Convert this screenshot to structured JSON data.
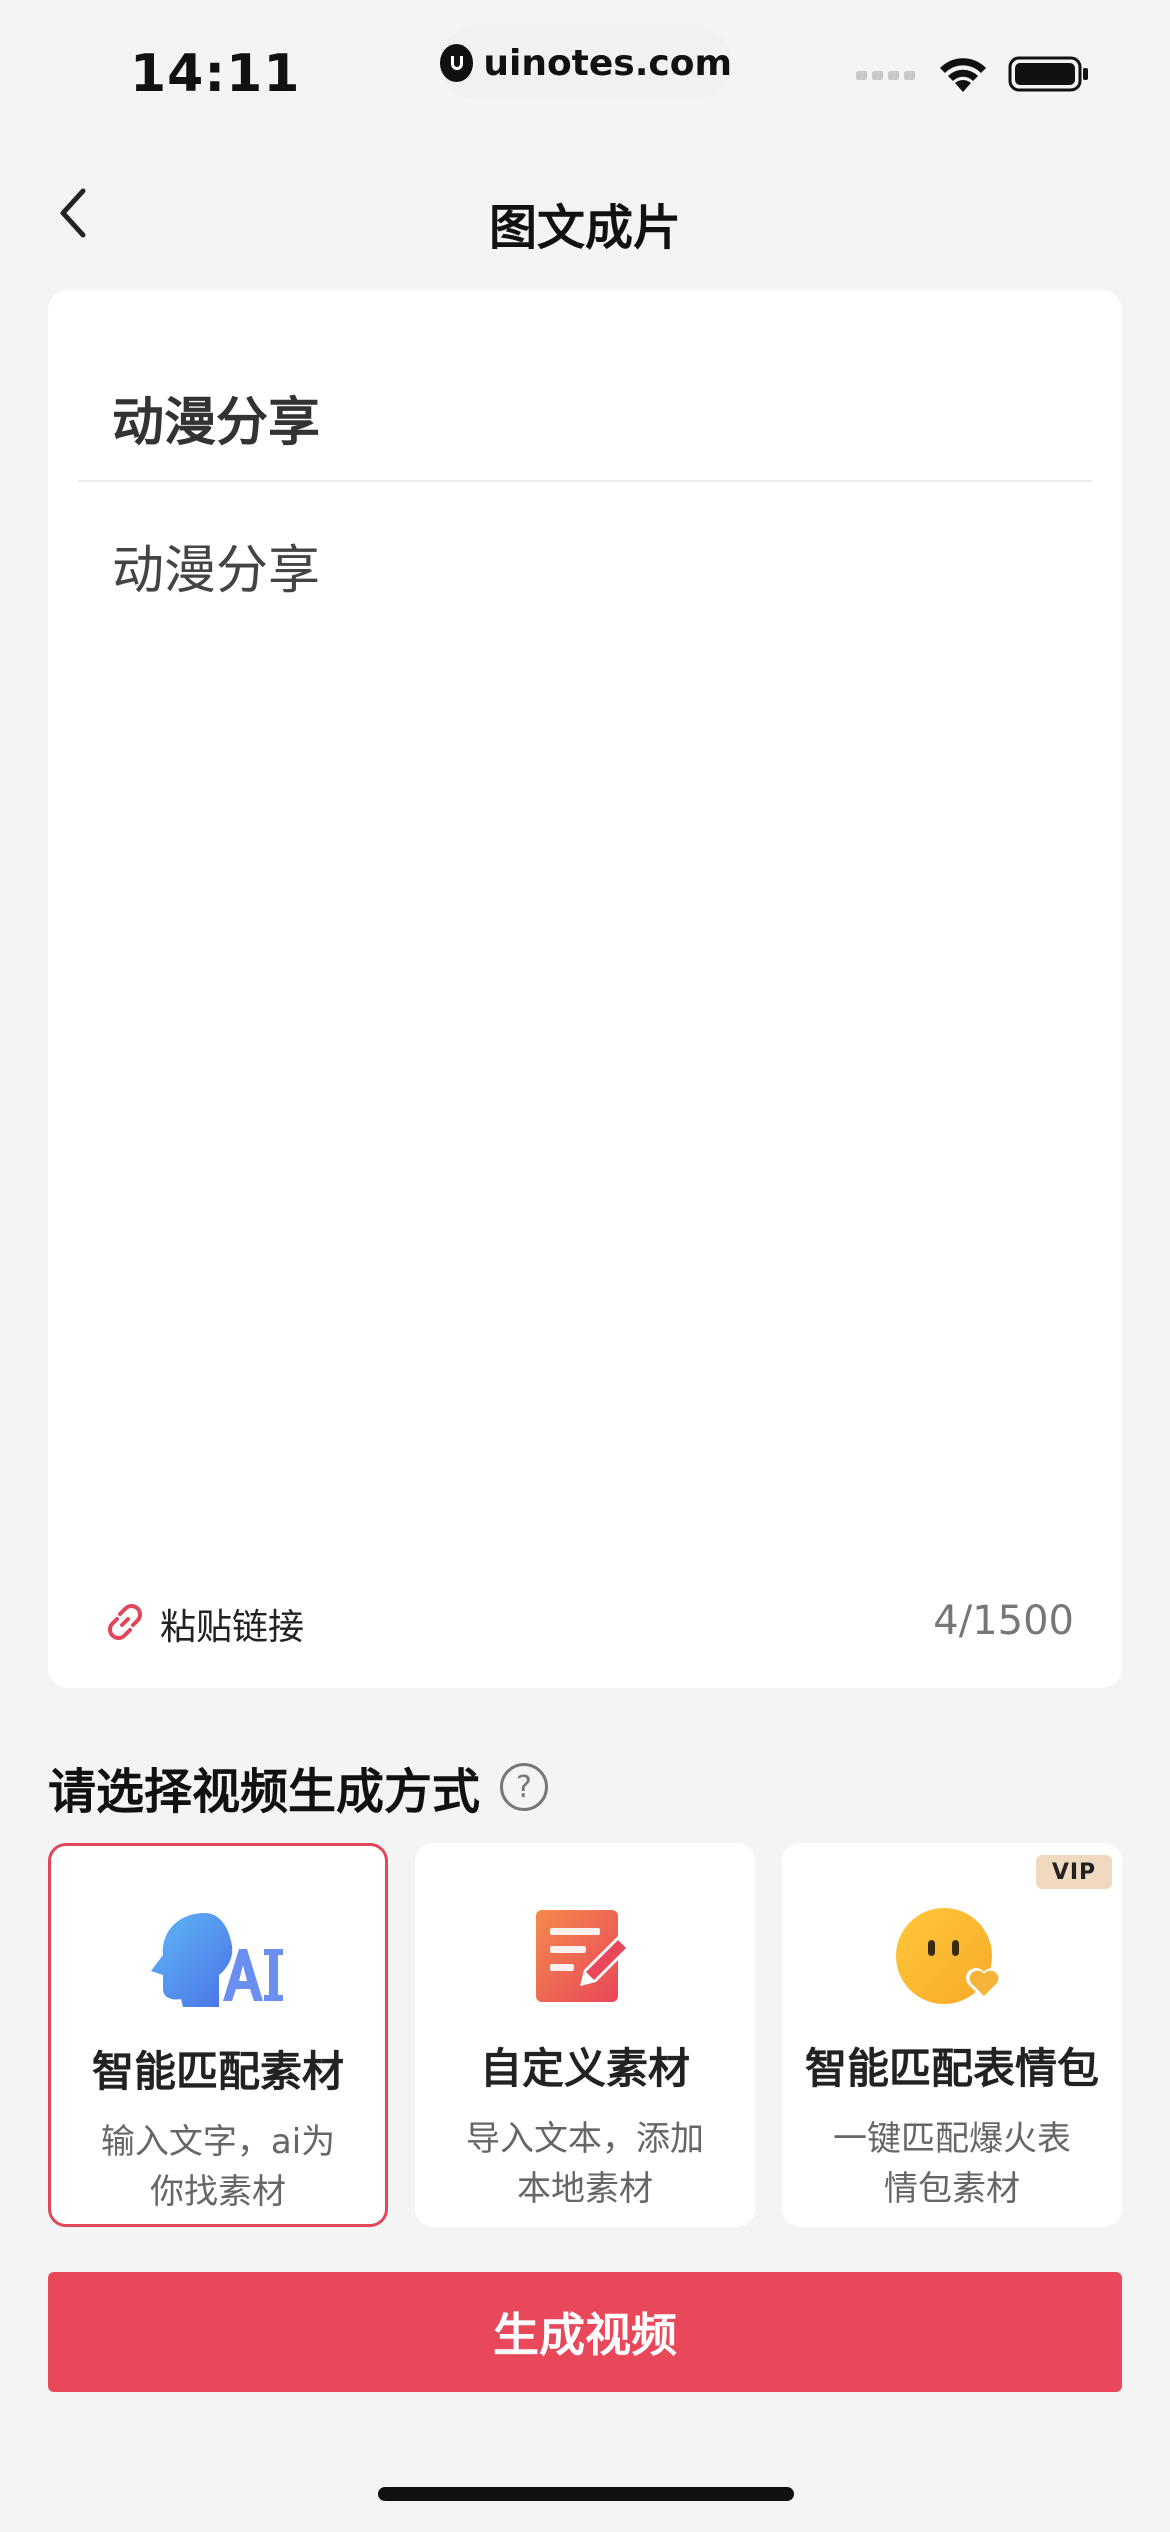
{
  "status_bar": {
    "time": "14:11",
    "url": "uinotes.com"
  },
  "nav": {
    "title": "图文成片",
    "back_icon": "chevron-left-icon"
  },
  "editor": {
    "title_value": "动漫分享",
    "body_value": "动漫分享",
    "paste_link_label": "粘贴链接",
    "char_count": "4/1500"
  },
  "section": {
    "title": "请选择视频生成方式",
    "help_symbol": "?"
  },
  "options": [
    {
      "icon": "ai-head-icon",
      "title": "智能匹配素材",
      "desc": "输入文字，ai为你找素材",
      "selected": true
    },
    {
      "icon": "edit-note-icon",
      "title": "自定义素材",
      "desc": "导入文本，添加本地素材",
      "selected": false
    },
    {
      "icon": "emoji-heart-icon",
      "title": "智能匹配表情包",
      "desc": "一键匹配爆火表情包素材",
      "selected": false,
      "badge": "VIP"
    }
  ],
  "generate_button": "生成视频",
  "colors": {
    "accent": "#e9475a",
    "background": "#f4f4f4",
    "card": "#ffffff"
  }
}
